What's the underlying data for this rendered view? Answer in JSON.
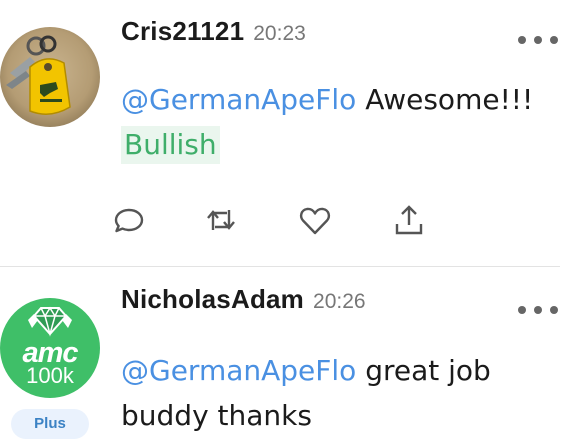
{
  "posts": [
    {
      "username": "Cris21121",
      "time": "20:23",
      "mention": "@GermanApeFlo",
      "text": " Awesome!!!",
      "sentiment": "Bullish",
      "avatar_icon": "keychain-photo"
    },
    {
      "username": "NicholasAdam",
      "time": "20:26",
      "mention": "@GermanApeFlo",
      "text": " great job buddy thanks",
      "badge": "Plus",
      "avatar_icon": "amc-diamond-logo",
      "avatar_logo_text": "amc",
      "avatar_sub_text": "100k"
    }
  ],
  "actions": {
    "reply_icon": "comment-icon",
    "reshare_icon": "reshare-icon",
    "like_icon": "heart-icon",
    "share_icon": "share-icon"
  },
  "colors": {
    "mention": "#4a90e2",
    "bullish_text": "#3fae6a",
    "bullish_bg": "#eaf6ee",
    "badge_bg": "#eaf2fd",
    "badge_text": "#3b82c4",
    "amc_green": "#3fbf68"
  }
}
